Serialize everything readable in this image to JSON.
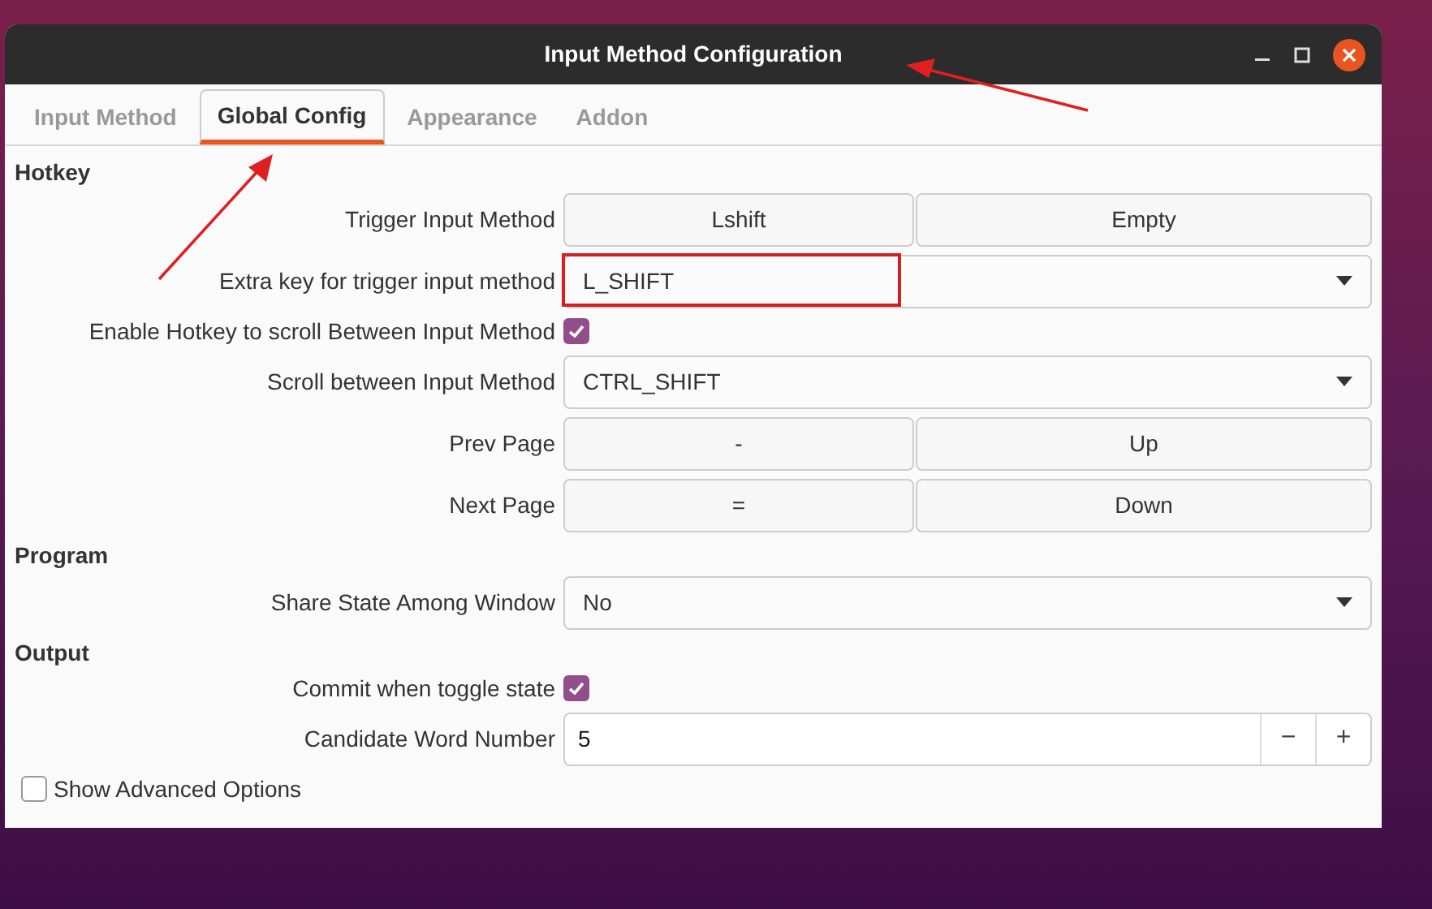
{
  "window": {
    "title": "Input Method Configuration"
  },
  "tabs": [
    {
      "label": "Input Method",
      "selected": false
    },
    {
      "label": "Global Config",
      "selected": true
    },
    {
      "label": "Appearance",
      "selected": false
    },
    {
      "label": "Addon",
      "selected": false
    }
  ],
  "sections": [
    {
      "title": "Hotkey",
      "rows": [
        {
          "kind": "keys",
          "label": "Trigger Input Method",
          "keys": [
            "Lshift",
            "Empty"
          ]
        },
        {
          "kind": "combo",
          "label": "Extra key for trigger input method",
          "value": "L_SHIFT",
          "highlighted": true
        },
        {
          "kind": "check",
          "label": "Enable Hotkey to scroll Between Input Method",
          "checked": true
        },
        {
          "kind": "combo",
          "label": "Scroll between Input Method",
          "value": "CTRL_SHIFT",
          "highlighted": false
        },
        {
          "kind": "keys",
          "label": "Prev Page",
          "keys": [
            "-",
            "Up"
          ]
        },
        {
          "kind": "keys",
          "label": "Next Page",
          "keys": [
            "=",
            "Down"
          ]
        }
      ]
    },
    {
      "title": "Program",
      "rows": [
        {
          "kind": "combo",
          "label": "Share State Among Window",
          "value": "No",
          "highlighted": false
        }
      ]
    },
    {
      "title": "Output",
      "rows": [
        {
          "kind": "check",
          "label": "Commit when toggle state",
          "checked": true
        },
        {
          "kind": "spin",
          "label": "Candidate Word Number",
          "value": "5",
          "minus": "−",
          "plus": "+"
        }
      ]
    }
  ],
  "advanced": {
    "label": "Show Advanced Options",
    "checked": false
  }
}
